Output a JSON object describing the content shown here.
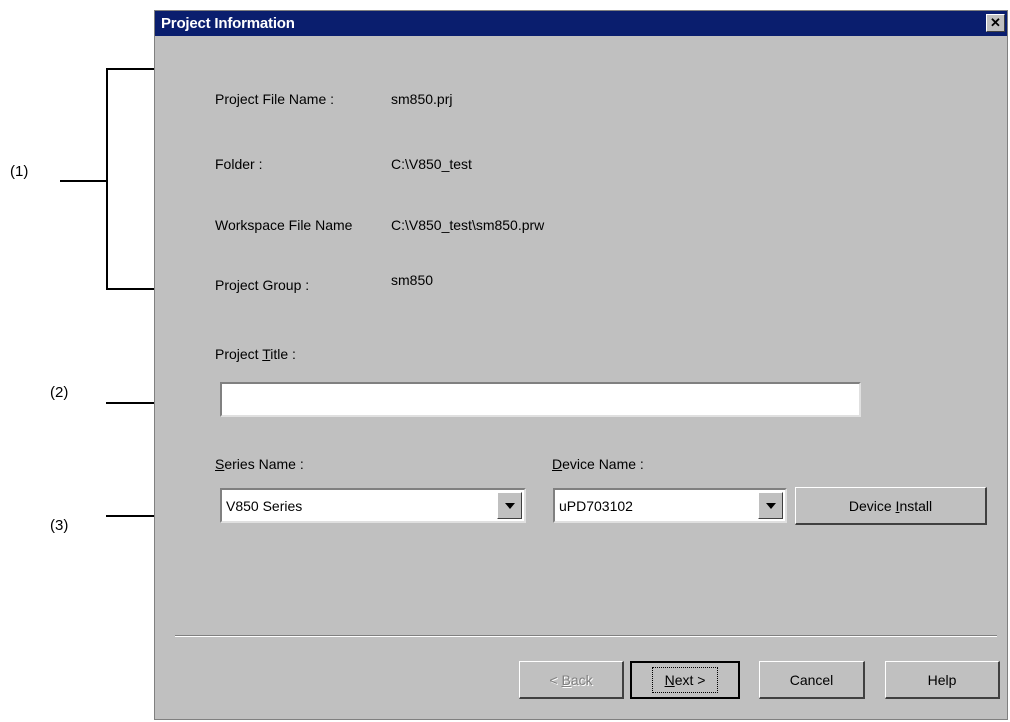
{
  "dialog": {
    "title": "Project Information",
    "close_glyph": "✕"
  },
  "info": {
    "project_file_name_label": "Project File Name :",
    "project_file_name_value": "sm850.prj",
    "folder_label": "Folder :",
    "folder_value": "C:\\V850_test",
    "workspace_file_name_label": "Workspace File Name",
    "workspace_file_name_value": "C:\\V850_test\\sm850.prw",
    "project_group_label": "Project Group :",
    "project_group_value": "sm850"
  },
  "project_title": {
    "label_pre": "Project ",
    "label_mnemonic": "T",
    "label_post": "itle :",
    "value": ""
  },
  "series": {
    "label_mnemonic": "S",
    "label_post": "eries Name :",
    "selected": "V850 Series"
  },
  "device": {
    "label_mnemonic": "D",
    "label_post": "evice Name :",
    "selected": "uPD703102",
    "install_pre": "Device ",
    "install_mnemonic": "I",
    "install_post": "nstall"
  },
  "buttons": {
    "back_pre": "< ",
    "back_mnemonic": "B",
    "back_post": "ack",
    "next_mnemonic": "N",
    "next_post": "ext >",
    "cancel": "Cancel",
    "help": "Help"
  },
  "callouts": {
    "c1": "(1)",
    "c2": "(2)",
    "c3": "(3)"
  }
}
